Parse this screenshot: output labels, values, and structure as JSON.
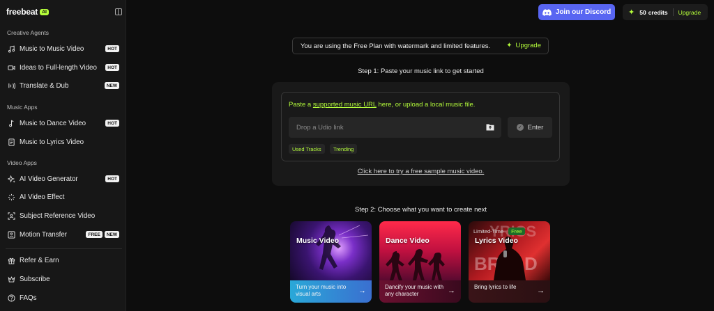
{
  "brand": {
    "name": "freebeat",
    "ai_badge": "AI"
  },
  "sidebar": {
    "sections": [
      {
        "label": "Creative Agents",
        "items": [
          {
            "label": "Music to Music Video",
            "icon": "music-note-icon",
            "tags": [
              "HOT"
            ]
          },
          {
            "label": "Ideas to Full-length Video",
            "icon": "video-camera-icon",
            "tags": [
              "HOT"
            ]
          },
          {
            "label": "Translate & Dub",
            "icon": "voice-translate-icon",
            "tags": [
              "NEW"
            ]
          }
        ]
      },
      {
        "label": "Music Apps",
        "items": [
          {
            "label": "Music to Dance Video",
            "icon": "music-note-single-icon",
            "tags": [
              "HOT"
            ]
          },
          {
            "label": "Music to Lyrics Video",
            "icon": "lyrics-doc-icon",
            "tags": []
          }
        ]
      },
      {
        "label": "Video Apps",
        "items": [
          {
            "label": "AI Video Generator",
            "icon": "sparkle-icon",
            "tags": [
              "HOT"
            ]
          },
          {
            "label": "AI Video Effect",
            "icon": "magic-icon",
            "tags": []
          },
          {
            "label": "Subject Reference Video",
            "icon": "subject-frame-icon",
            "tags": []
          },
          {
            "label": "Motion Transfer",
            "icon": "motion-person-icon",
            "tags": [
              "FREE",
              "NEW"
            ]
          }
        ]
      }
    ],
    "footer_items": [
      {
        "label": "Refer & Earn",
        "icon": "gift-icon"
      },
      {
        "label": "Subscribe",
        "icon": "crown-icon"
      },
      {
        "label": "FAQs",
        "icon": "question-icon"
      }
    ]
  },
  "header": {
    "discord_label": "Join our Discord",
    "credits_count": "50",
    "credits_word": "credits",
    "upgrade_label": "Upgrade"
  },
  "banner": {
    "text": "You are using the Free Plan with watermark and limited features.",
    "upgrade_label": "Upgrade"
  },
  "step1": {
    "title": "Step 1: Paste your music link to get started",
    "paste_prefix": "Paste a ",
    "paste_link": "supported music URL",
    "paste_suffix": " here, or upload a local music file.",
    "input_placeholder": "Drop a Udio link",
    "enter_label": "Enter",
    "chips": [
      "Used Tracks",
      "Trending"
    ],
    "sample_link": "Click here to try a free sample music video."
  },
  "step2": {
    "title": "Step 2: Choose what you want to create next",
    "cards": [
      {
        "title": "Music Video",
        "desc": "Turn your music into visual arts",
        "limited_label": "",
        "free_label": ""
      },
      {
        "title": "Dance Video",
        "desc": "Dancify your music with any character",
        "limited_label": "",
        "free_label": ""
      },
      {
        "title": "Lyrics Video",
        "desc": "Bring lyrics to life",
        "limited_label": "Limited-Time",
        "free_label": "Free"
      }
    ]
  },
  "colors": {
    "accent": "#b6ff3b",
    "discord": "#5865f2",
    "background": "#0d0d0d",
    "sidebar": "#171717"
  }
}
